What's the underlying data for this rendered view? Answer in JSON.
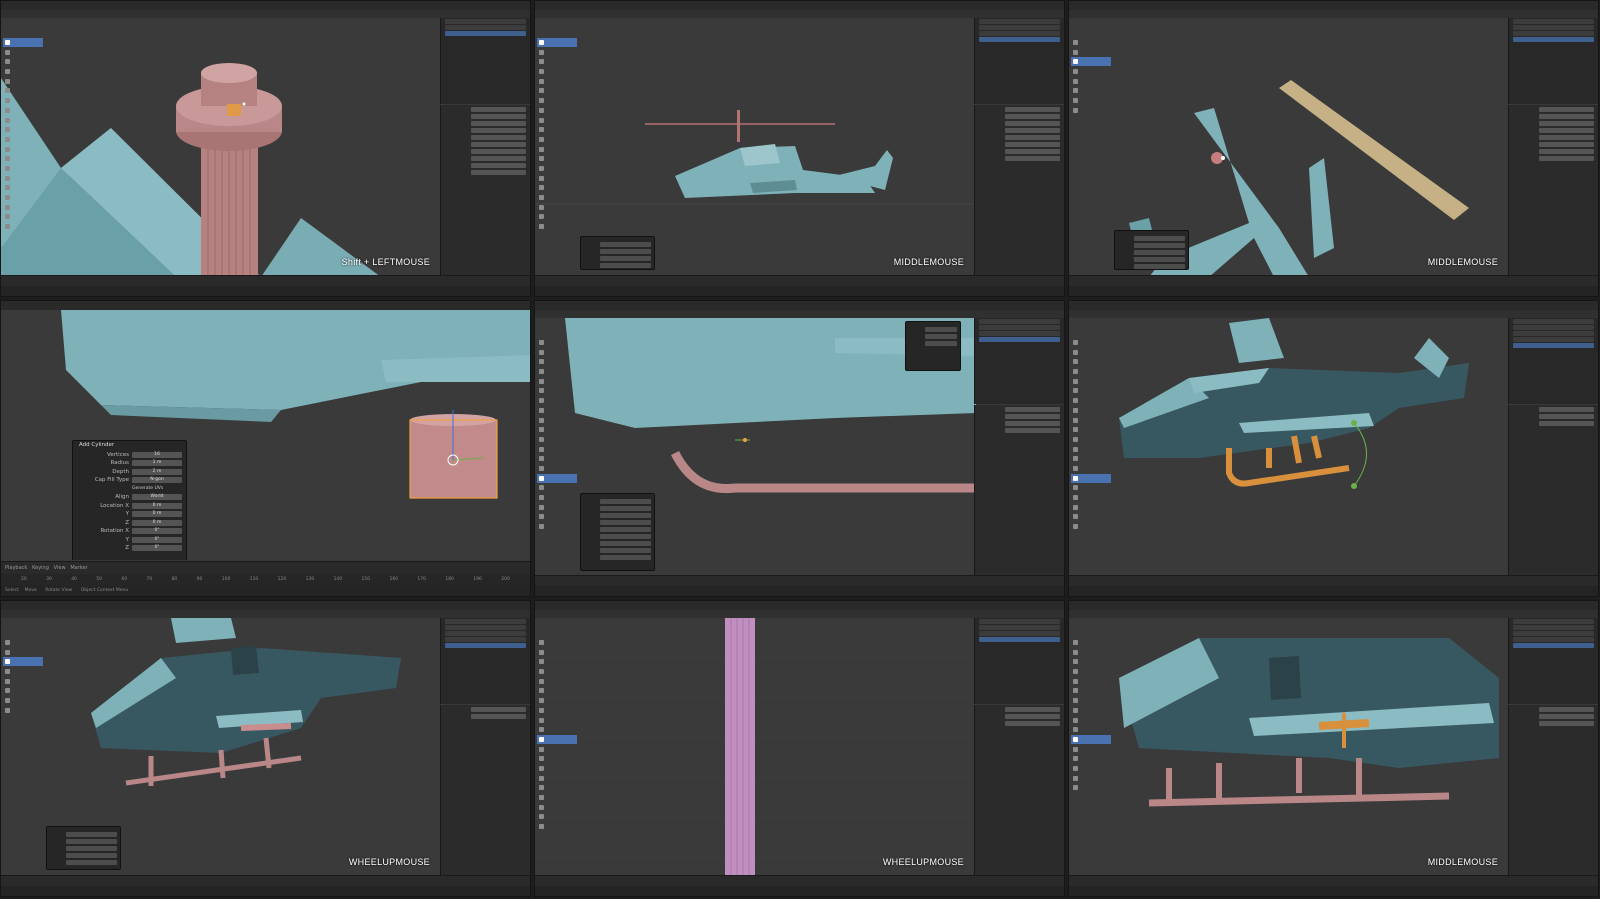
{
  "overlays": {
    "cell1": "Shift + LEFTMOUSE",
    "cell2": "MIDDLEMOUSE",
    "cell3": "MIDDLEMOUSE",
    "cell7": "WHEELUPMOUSE",
    "cell8": "WHEELUPMOUSE",
    "cell9": "MIDDLEMOUSE"
  },
  "add_cylinder": {
    "title": "Add Cylinder",
    "rows": [
      {
        "label": "Vertices",
        "value": "16"
      },
      {
        "label": "Radius",
        "value": "1 m"
      },
      {
        "label": "Depth",
        "value": "2 m"
      },
      {
        "label": "Cap Fill Type",
        "value": "N-gon"
      },
      {
        "label": "Generate UVs",
        "value": ""
      },
      {
        "label": "Align",
        "value": "World"
      },
      {
        "label": "Location X",
        "value": "0 m"
      },
      {
        "label": "Y",
        "value": "0 m"
      },
      {
        "label": "Z",
        "value": "0 m"
      },
      {
        "label": "Rotation X",
        "value": "0°"
      },
      {
        "label": "Y",
        "value": "0°"
      },
      {
        "label": "Z",
        "value": "0°"
      }
    ]
  },
  "timeline4": {
    "menu": [
      "Playback",
      "Keying",
      "View",
      "Marker"
    ],
    "frames": [
      "20",
      "30",
      "40",
      "50",
      "60",
      "70",
      "80",
      "90",
      "100",
      "110",
      "120",
      "130",
      "140",
      "150",
      "160",
      "170",
      "180",
      "190",
      "200"
    ]
  },
  "status4": [
    "Select",
    "Move",
    "Rotate View",
    "Object Context Menu"
  ],
  "colors": {
    "accent": "#4a72b0",
    "mesh_teal": "#7fb1b9",
    "mesh_pink": "#b98787",
    "mesh_orange": "#d8903d"
  }
}
